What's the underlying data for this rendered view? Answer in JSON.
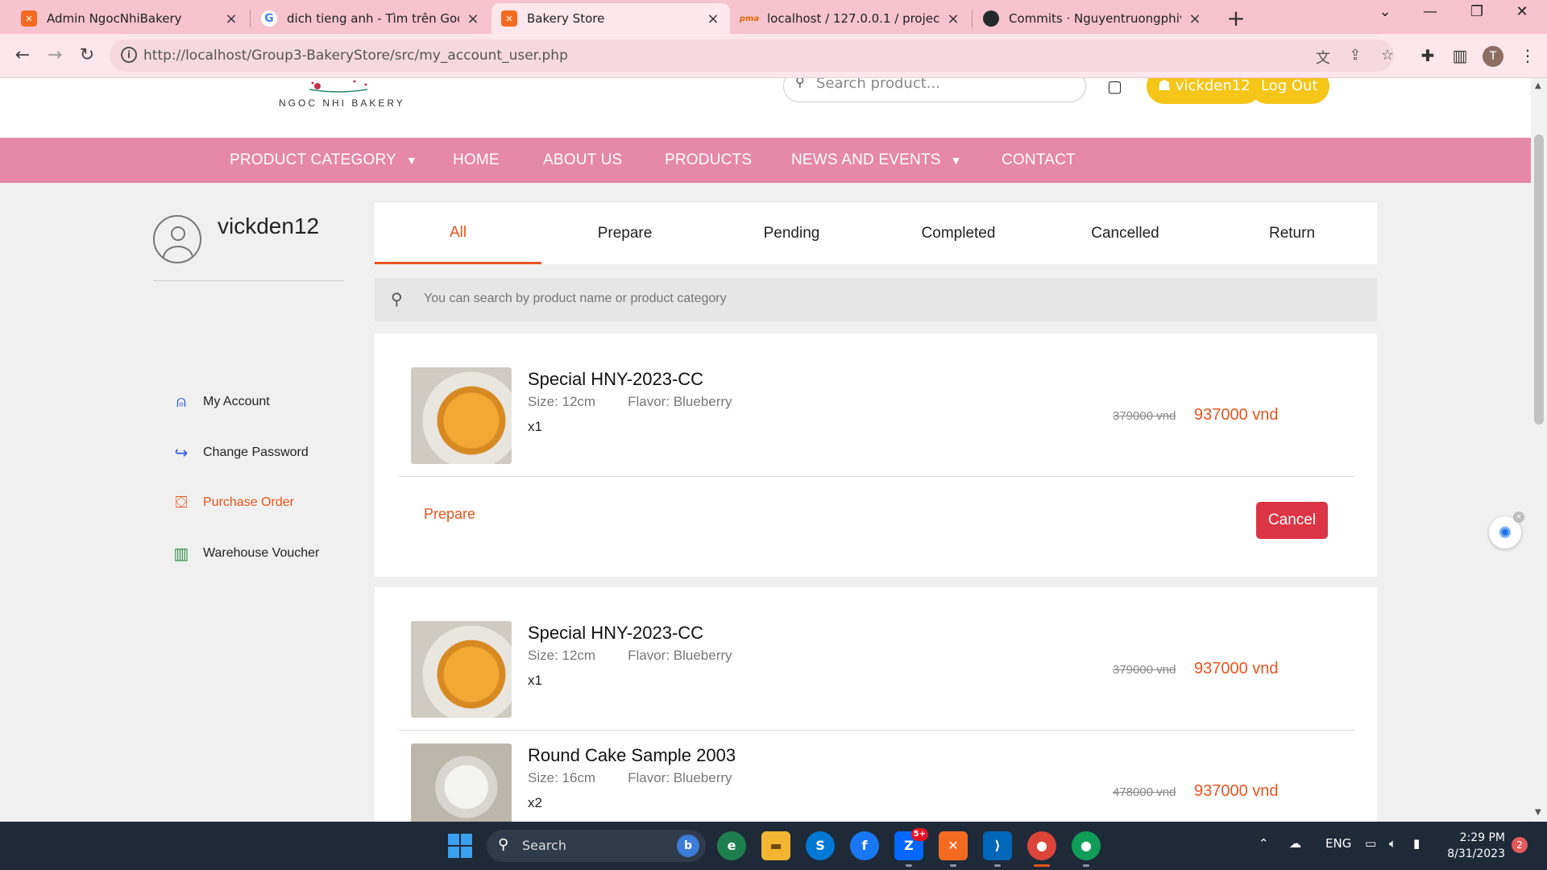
{
  "browser": {
    "tabs": [
      {
        "title": "Admin NgocNhiBakery",
        "icon": "xampp-icon",
        "active": false
      },
      {
        "title": "dich tieng anh - Tìm trên Google",
        "icon": "google-icon",
        "active": false
      },
      {
        "title": "Bakery Store",
        "icon": "xampp-icon",
        "active": true
      },
      {
        "title": "localhost / 127.0.0.1 / projecthk2",
        "icon": "phpmyadmin-icon",
        "active": false
      },
      {
        "title": "Commits · Nguyentruongphivold",
        "icon": "github-icon",
        "active": false
      }
    ],
    "url": "http://localhost/Group3-BakeryStore/src/my_account_user.php",
    "profile_initial": "T"
  },
  "site": {
    "logo_text": "NGOC NHI BAKERY",
    "search_placeholder": "Search product...",
    "username_pill": "vickden12",
    "logout_label": "Log Out",
    "nav": [
      {
        "label": "PRODUCT CATEGORY",
        "dropdown": true
      },
      {
        "label": "HOME",
        "dropdown": false
      },
      {
        "label": "ABOUT US",
        "dropdown": false
      },
      {
        "label": "PRODUCTS",
        "dropdown": false
      },
      {
        "label": "NEWS AND EVENTS",
        "dropdown": true
      },
      {
        "label": "CONTACT",
        "dropdown": false
      }
    ],
    "accent_color": "#e8541e",
    "nav_color": "#e688a8"
  },
  "sidebar": {
    "username": "vickden12",
    "items": [
      {
        "label": "My Account",
        "icon": "user-icon",
        "active": false
      },
      {
        "label": "Change Password",
        "icon": "redo-icon",
        "active": false
      },
      {
        "label": "Purchase Order",
        "icon": "shopping-bag-icon",
        "active": true
      },
      {
        "label": "Warehouse Voucher",
        "icon": "barcode-icon",
        "active": false
      }
    ]
  },
  "orders": {
    "tabs": [
      "All",
      "Prepare",
      "Pending",
      "Completed",
      "Cancelled",
      "Return"
    ],
    "active_tab": "All",
    "search_placeholder": "You can search by product name or product category",
    "cards": [
      {
        "items": [
          {
            "name": "Special HNY-2023-CC",
            "size": "Size: 12cm",
            "flavor": "Flavor: Blueberry",
            "qty": "x1",
            "old_price": "379000 vnd",
            "price": "937000 vnd"
          }
        ],
        "status": "Prepare",
        "action": "Cancel"
      },
      {
        "items": [
          {
            "name": "Special HNY-2023-CC",
            "size": "Size: 12cm",
            "flavor": "Flavor: Blueberry",
            "qty": "x1",
            "old_price": "379000 vnd",
            "price": "937000 vnd"
          },
          {
            "name": "Round Cake Sample 2003",
            "size": "Size: 16cm",
            "flavor": "Flavor: Blueberry",
            "qty": "x2",
            "old_price": "478000 vnd",
            "price": "937000 vnd"
          }
        ]
      }
    ]
  },
  "taskbar": {
    "search_label": "Search",
    "zalo_badge": "5+",
    "language": "ENG",
    "time": "2:29 PM",
    "date": "8/31/2023",
    "notifications": "2"
  }
}
